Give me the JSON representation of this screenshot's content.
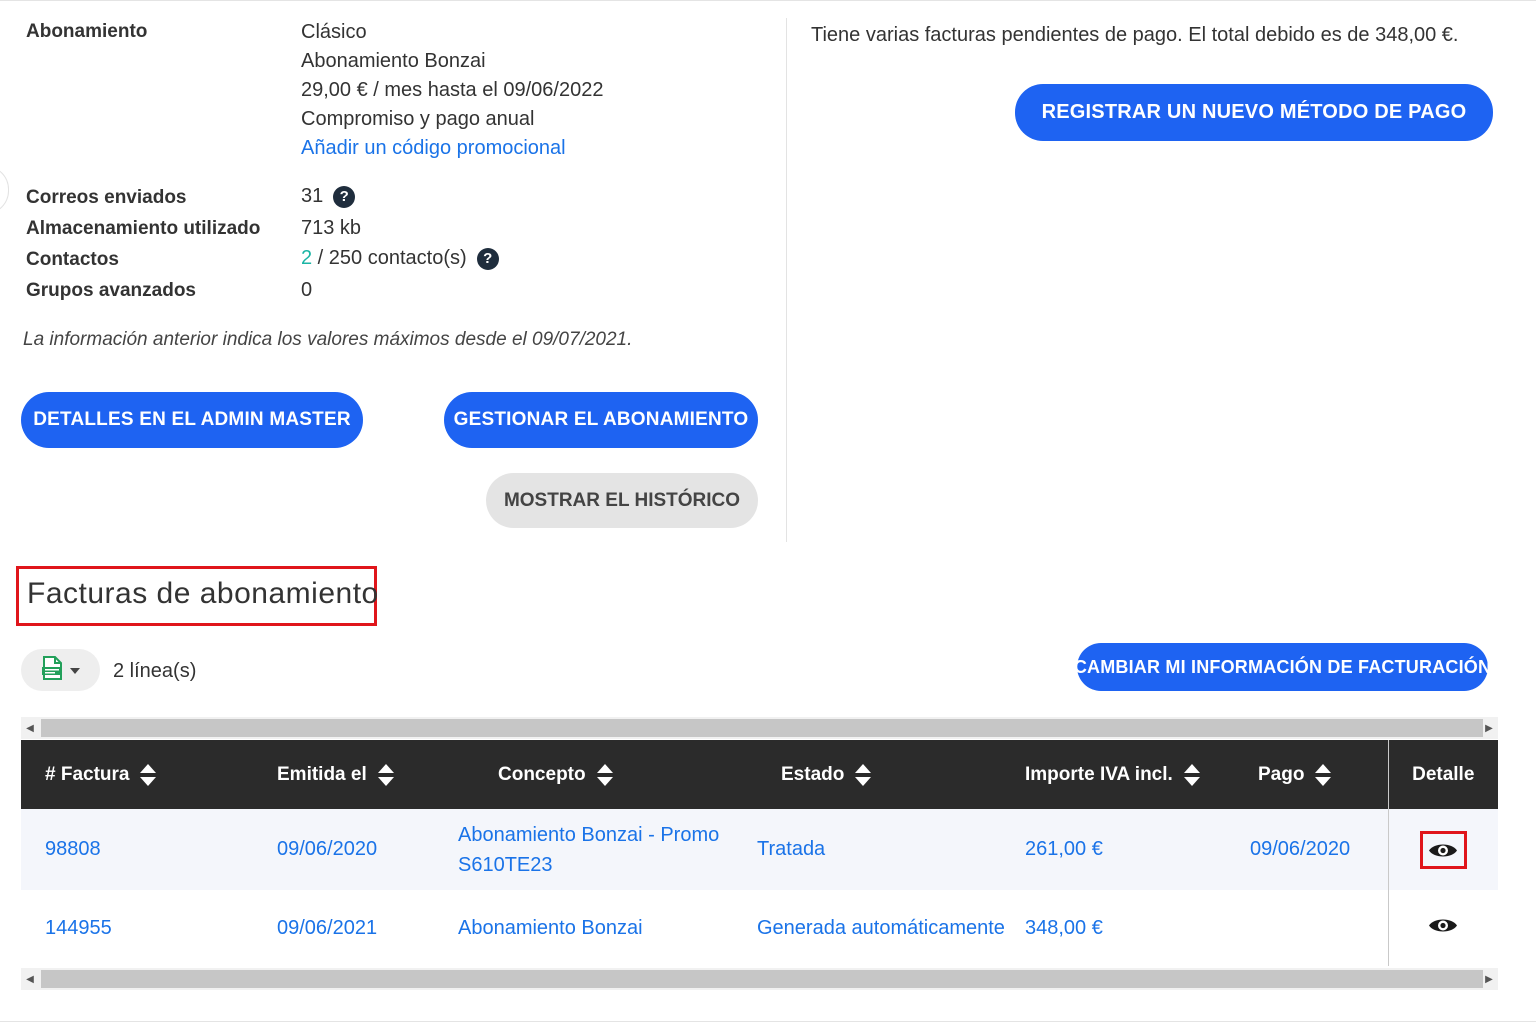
{
  "subscription": {
    "label": "Abonamiento",
    "plan": "Clásico",
    "name": "Abonamiento Bonzai",
    "price": "29,00 € / mes hasta el 09/06/2022",
    "commitment": "Compromiso y pago anual",
    "promo_link": "Añadir un código promocional"
  },
  "stats": {
    "emails_label": "Correos enviados",
    "emails_value": "31",
    "storage_label": "Almacenamiento utilizado",
    "storage_value": "713 kb",
    "contacts_label": "Contactos",
    "contacts_used": "2",
    "contacts_total": " / 250 contacto(s)",
    "groups_label": "Grupos avanzados",
    "groups_value": "0",
    "help_glyph": "?"
  },
  "note": "La información anterior indica los valores máximos desde el 09/07/2021.",
  "buttons": {
    "admin_master": "DETALLES EN EL ADMIN MASTER",
    "manage": "GESTIONAR EL ABONAMIENTO",
    "history": "MOSTRAR EL HISTÓRICO",
    "new_payment": "REGISTRAR UN NUEVO MÉTODO DE PAGO",
    "billing_info": "CAMBIAR MI INFORMACIÓN DE FACTURACIÓN"
  },
  "pending_message": "Tiene varias facturas pendientes de pago. El total debido es de 348,00 €.",
  "invoices": {
    "title": "Facturas de abonamiento",
    "line_count": "2 línea(s)",
    "columns": [
      "# Factura",
      "Emitida el",
      "Concepto",
      "Estado",
      "Importe IVA incl.",
      "Pago",
      "Detalle"
    ],
    "rows": [
      {
        "number": "98808",
        "issued": "09/06/2020",
        "concept_1": "Abonamiento Bonzai - Promo",
        "concept_2": "S610TE23",
        "status": "Tratada",
        "amount": "261,00 €",
        "payment": "09/06/2020"
      },
      {
        "number": "144955",
        "issued": "09/06/2021",
        "concept_1": "Abonamiento Bonzai",
        "concept_2": "",
        "status": "Generada automáticamente",
        "amount": "348,00 €",
        "payment": ""
      }
    ]
  },
  "colors": {
    "primary": "#1e63f2",
    "link": "#1a73e8",
    "contacts_used": "#1bb5a5",
    "table_header": "#2b2b2b",
    "highlight": "#e0151b"
  },
  "icons": [
    "help-icon",
    "csv-file-icon",
    "caret-down-icon",
    "sort-icon",
    "eye-icon",
    "scroll-left-icon",
    "scroll-right-icon"
  ]
}
